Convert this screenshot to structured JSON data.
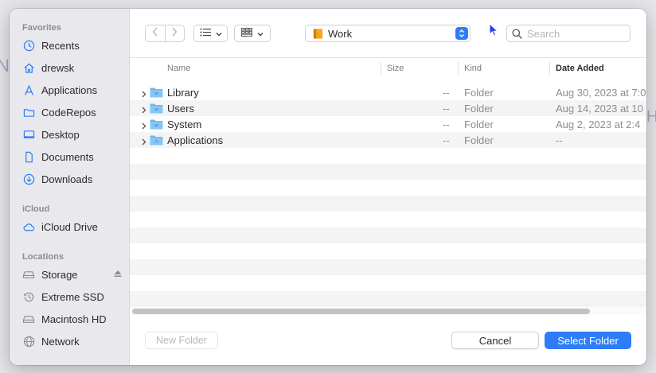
{
  "background_glyphs": {
    "left": "N",
    "right": "H"
  },
  "sidebar": {
    "favorites_title": "Favorites",
    "favorites": [
      {
        "label": "Recents",
        "icon": "clock-icon"
      },
      {
        "label": "drewsk",
        "icon": "home-icon"
      },
      {
        "label": "Applications",
        "icon": "applications-icon"
      },
      {
        "label": "CodeRepos",
        "icon": "folder-icon"
      },
      {
        "label": "Desktop",
        "icon": "desktop-icon"
      },
      {
        "label": "Documents",
        "icon": "document-icon"
      },
      {
        "label": "Downloads",
        "icon": "download-icon"
      }
    ],
    "icloud_title": "iCloud",
    "icloud": [
      {
        "label": "iCloud Drive",
        "icon": "cloud-icon"
      }
    ],
    "locations_title": "Locations",
    "locations": [
      {
        "label": "Storage",
        "icon": "drive-icon",
        "ejectable": true
      },
      {
        "label": "Extreme SSD",
        "icon": "time-machine-icon"
      },
      {
        "label": "Macintosh HD",
        "icon": "drive-icon"
      },
      {
        "label": "Network",
        "icon": "globe-icon"
      }
    ]
  },
  "toolbar": {
    "path_label": "Work",
    "search_placeholder": "Search"
  },
  "columns": {
    "name": "Name",
    "size": "Size",
    "kind": "Kind",
    "date_added": "Date Added"
  },
  "files": [
    {
      "name": "Library",
      "size": "--",
      "kind": "Folder",
      "date": "Aug 30, 2023 at 7:0"
    },
    {
      "name": "Users",
      "size": "--",
      "kind": "Folder",
      "date": "Aug 14, 2023 at 10"
    },
    {
      "name": "System",
      "size": "--",
      "kind": "Folder",
      "date": "Aug 2, 2023 at 2:4"
    },
    {
      "name": "Applications",
      "size": "--",
      "kind": "Folder",
      "date": "--"
    }
  ],
  "buttons": {
    "new_folder": "New Folder",
    "cancel": "Cancel",
    "select_folder": "Select Folder"
  },
  "colors": {
    "accent": "#2f7df6",
    "sidebar_icon": "#2f7df6",
    "folder": "#6db6ef"
  }
}
